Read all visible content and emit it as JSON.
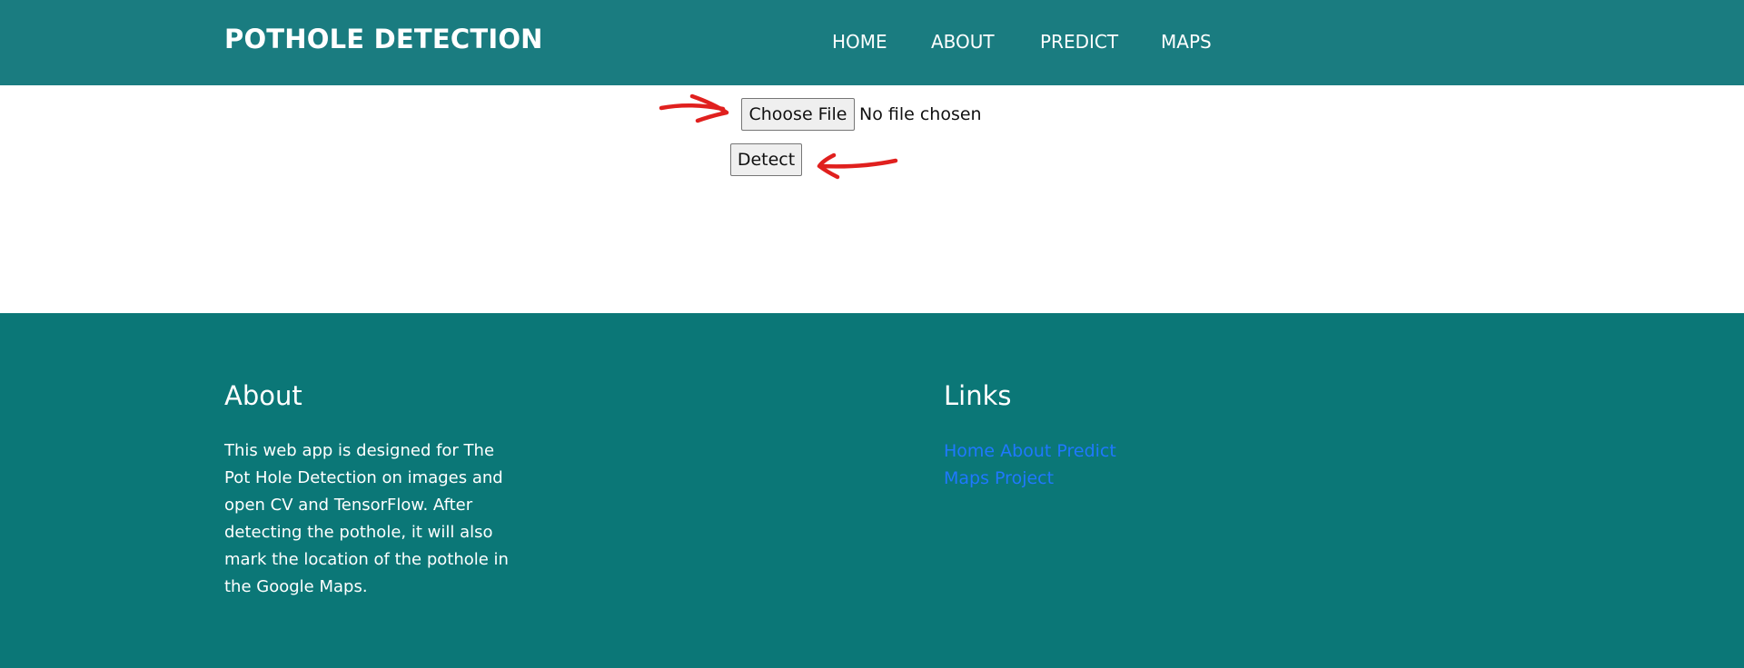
{
  "navbar": {
    "brand": "POTHOLE DETECTION",
    "links": [
      "HOME",
      "ABOUT",
      "PREDICT",
      "MAPS"
    ],
    "background": "#1a7c80"
  },
  "upload": {
    "choose_file_label": "Choose File",
    "file_status": "No file chosen",
    "detect_label": "Detect",
    "annotation_color": "#e0201e"
  },
  "footer": {
    "background": "#0b7777",
    "about": {
      "title": "About",
      "text": "This web app is designed for The Pot Hole Detection on images and open CV and TensorFlow. After detecting the pothole, it will also mark the location of the pothole in the Google Maps."
    },
    "links": {
      "title": "Links",
      "items": [
        "Home",
        "About",
        "Predict",
        "Maps",
        "Project"
      ],
      "color": "#1f78ff"
    }
  }
}
